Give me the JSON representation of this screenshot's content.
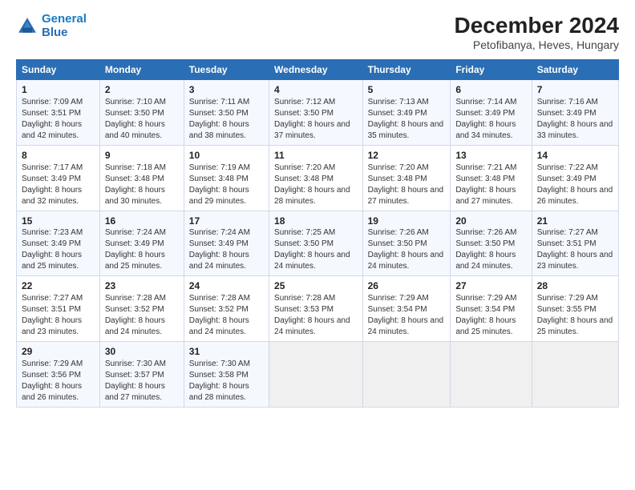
{
  "logo": {
    "line1": "General",
    "line2": "Blue"
  },
  "title": "December 2024",
  "subtitle": "Petofibanya, Heves, Hungary",
  "days_of_week": [
    "Sunday",
    "Monday",
    "Tuesday",
    "Wednesday",
    "Thursday",
    "Friday",
    "Saturday"
  ],
  "weeks": [
    [
      {
        "day": "1",
        "sunrise": "Sunrise: 7:09 AM",
        "sunset": "Sunset: 3:51 PM",
        "daylight": "Daylight: 8 hours and 42 minutes."
      },
      {
        "day": "2",
        "sunrise": "Sunrise: 7:10 AM",
        "sunset": "Sunset: 3:50 PM",
        "daylight": "Daylight: 8 hours and 40 minutes."
      },
      {
        "day": "3",
        "sunrise": "Sunrise: 7:11 AM",
        "sunset": "Sunset: 3:50 PM",
        "daylight": "Daylight: 8 hours and 38 minutes."
      },
      {
        "day": "4",
        "sunrise": "Sunrise: 7:12 AM",
        "sunset": "Sunset: 3:50 PM",
        "daylight": "Daylight: 8 hours and 37 minutes."
      },
      {
        "day": "5",
        "sunrise": "Sunrise: 7:13 AM",
        "sunset": "Sunset: 3:49 PM",
        "daylight": "Daylight: 8 hours and 35 minutes."
      },
      {
        "day": "6",
        "sunrise": "Sunrise: 7:14 AM",
        "sunset": "Sunset: 3:49 PM",
        "daylight": "Daylight: 8 hours and 34 minutes."
      },
      {
        "day": "7",
        "sunrise": "Sunrise: 7:16 AM",
        "sunset": "Sunset: 3:49 PM",
        "daylight": "Daylight: 8 hours and 33 minutes."
      }
    ],
    [
      {
        "day": "8",
        "sunrise": "Sunrise: 7:17 AM",
        "sunset": "Sunset: 3:49 PM",
        "daylight": "Daylight: 8 hours and 32 minutes."
      },
      {
        "day": "9",
        "sunrise": "Sunrise: 7:18 AM",
        "sunset": "Sunset: 3:48 PM",
        "daylight": "Daylight: 8 hours and 30 minutes."
      },
      {
        "day": "10",
        "sunrise": "Sunrise: 7:19 AM",
        "sunset": "Sunset: 3:48 PM",
        "daylight": "Daylight: 8 hours and 29 minutes."
      },
      {
        "day": "11",
        "sunrise": "Sunrise: 7:20 AM",
        "sunset": "Sunset: 3:48 PM",
        "daylight": "Daylight: 8 hours and 28 minutes."
      },
      {
        "day": "12",
        "sunrise": "Sunrise: 7:20 AM",
        "sunset": "Sunset: 3:48 PM",
        "daylight": "Daylight: 8 hours and 27 minutes."
      },
      {
        "day": "13",
        "sunrise": "Sunrise: 7:21 AM",
        "sunset": "Sunset: 3:48 PM",
        "daylight": "Daylight: 8 hours and 27 minutes."
      },
      {
        "day": "14",
        "sunrise": "Sunrise: 7:22 AM",
        "sunset": "Sunset: 3:49 PM",
        "daylight": "Daylight: 8 hours and 26 minutes."
      }
    ],
    [
      {
        "day": "15",
        "sunrise": "Sunrise: 7:23 AM",
        "sunset": "Sunset: 3:49 PM",
        "daylight": "Daylight: 8 hours and 25 minutes."
      },
      {
        "day": "16",
        "sunrise": "Sunrise: 7:24 AM",
        "sunset": "Sunset: 3:49 PM",
        "daylight": "Daylight: 8 hours and 25 minutes."
      },
      {
        "day": "17",
        "sunrise": "Sunrise: 7:24 AM",
        "sunset": "Sunset: 3:49 PM",
        "daylight": "Daylight: 8 hours and 24 minutes."
      },
      {
        "day": "18",
        "sunrise": "Sunrise: 7:25 AM",
        "sunset": "Sunset: 3:50 PM",
        "daylight": "Daylight: 8 hours and 24 minutes."
      },
      {
        "day": "19",
        "sunrise": "Sunrise: 7:26 AM",
        "sunset": "Sunset: 3:50 PM",
        "daylight": "Daylight: 8 hours and 24 minutes."
      },
      {
        "day": "20",
        "sunrise": "Sunrise: 7:26 AM",
        "sunset": "Sunset: 3:50 PM",
        "daylight": "Daylight: 8 hours and 24 minutes."
      },
      {
        "day": "21",
        "sunrise": "Sunrise: 7:27 AM",
        "sunset": "Sunset: 3:51 PM",
        "daylight": "Daylight: 8 hours and 23 minutes."
      }
    ],
    [
      {
        "day": "22",
        "sunrise": "Sunrise: 7:27 AM",
        "sunset": "Sunset: 3:51 PM",
        "daylight": "Daylight: 8 hours and 23 minutes."
      },
      {
        "day": "23",
        "sunrise": "Sunrise: 7:28 AM",
        "sunset": "Sunset: 3:52 PM",
        "daylight": "Daylight: 8 hours and 24 minutes."
      },
      {
        "day": "24",
        "sunrise": "Sunrise: 7:28 AM",
        "sunset": "Sunset: 3:52 PM",
        "daylight": "Daylight: 8 hours and 24 minutes."
      },
      {
        "day": "25",
        "sunrise": "Sunrise: 7:28 AM",
        "sunset": "Sunset: 3:53 PM",
        "daylight": "Daylight: 8 hours and 24 minutes."
      },
      {
        "day": "26",
        "sunrise": "Sunrise: 7:29 AM",
        "sunset": "Sunset: 3:54 PM",
        "daylight": "Daylight: 8 hours and 24 minutes."
      },
      {
        "day": "27",
        "sunrise": "Sunrise: 7:29 AM",
        "sunset": "Sunset: 3:54 PM",
        "daylight": "Daylight: 8 hours and 25 minutes."
      },
      {
        "day": "28",
        "sunrise": "Sunrise: 7:29 AM",
        "sunset": "Sunset: 3:55 PM",
        "daylight": "Daylight: 8 hours and 25 minutes."
      }
    ],
    [
      {
        "day": "29",
        "sunrise": "Sunrise: 7:29 AM",
        "sunset": "Sunset: 3:56 PM",
        "daylight": "Daylight: 8 hours and 26 minutes."
      },
      {
        "day": "30",
        "sunrise": "Sunrise: 7:30 AM",
        "sunset": "Sunset: 3:57 PM",
        "daylight": "Daylight: 8 hours and 27 minutes."
      },
      {
        "day": "31",
        "sunrise": "Sunrise: 7:30 AM",
        "sunset": "Sunset: 3:58 PM",
        "daylight": "Daylight: 8 hours and 28 minutes."
      },
      null,
      null,
      null,
      null
    ]
  ]
}
